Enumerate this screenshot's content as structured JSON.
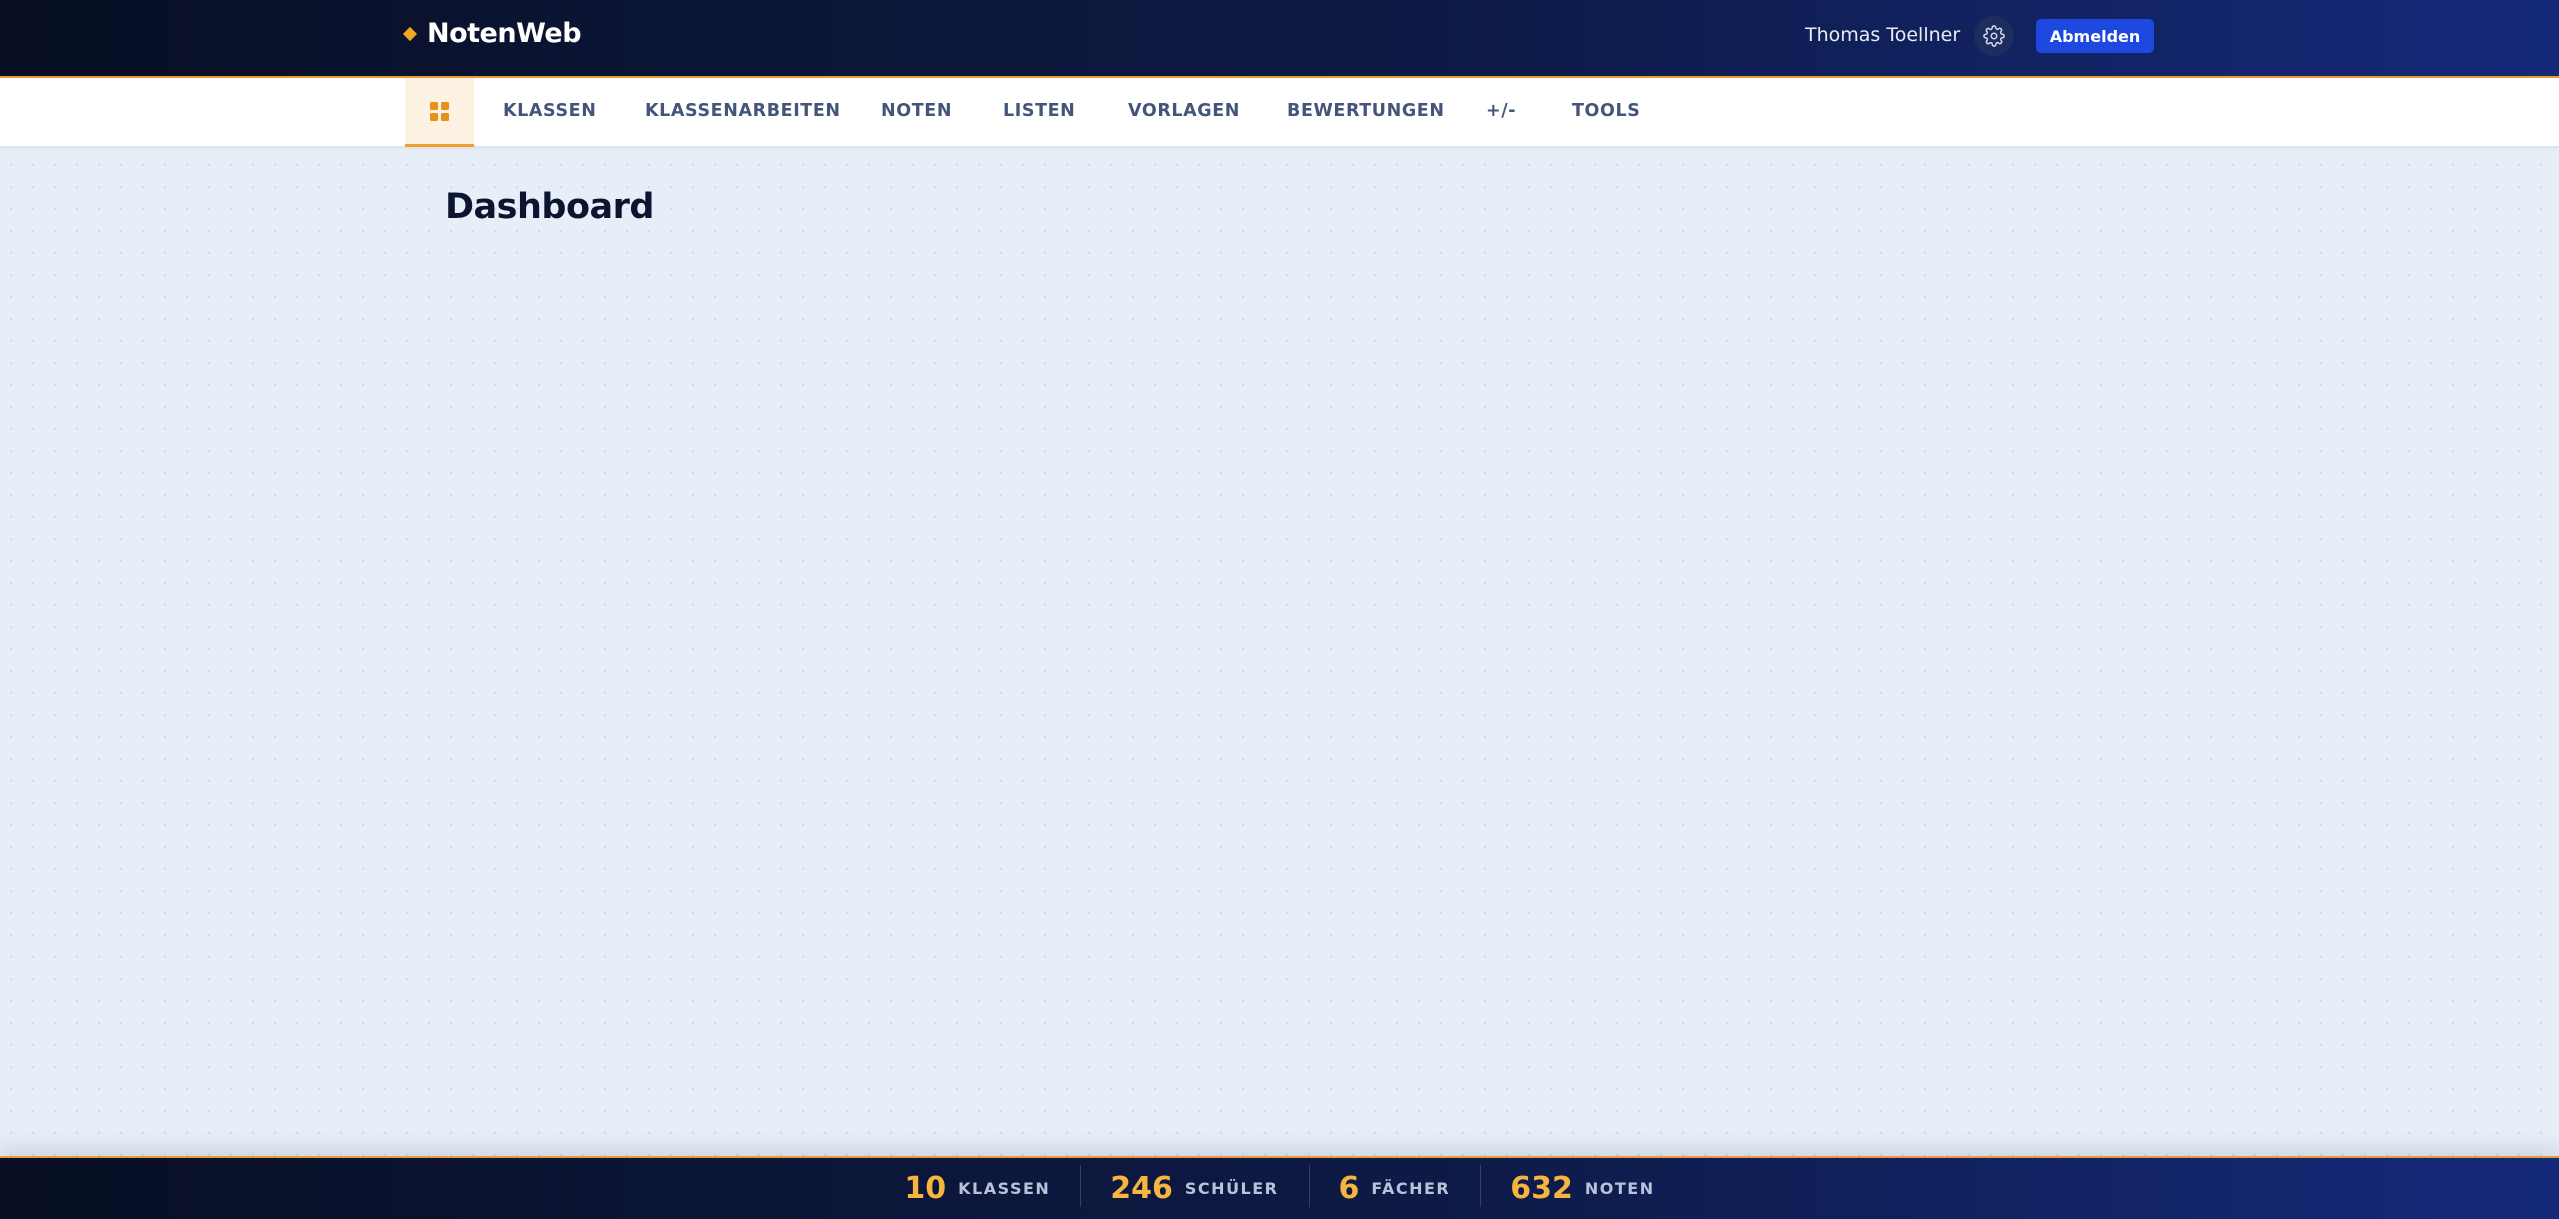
{
  "brand": {
    "name": "NotenWeb",
    "accent": "#f5a623"
  },
  "header": {
    "user_name": "Thomas Toellner",
    "settings_icon": "gear-icon",
    "logout_label": "Abmelden"
  },
  "nav": {
    "home_icon": "grid-icon",
    "items": [
      {
        "label": "KLASSEN"
      },
      {
        "label": "KLASSENARBEITEN"
      },
      {
        "label": "NOTEN"
      },
      {
        "label": "LISTEN"
      },
      {
        "label": "VORLAGEN"
      },
      {
        "label": "BEWERTUNGEN"
      },
      {
        "label": "+/-"
      },
      {
        "label": "TOOLS"
      }
    ]
  },
  "main": {
    "title": "Dashboard"
  },
  "footer": {
    "stats": [
      {
        "value": "10",
        "label": "KLASSEN"
      },
      {
        "value": "246",
        "label": "SCHÜLER"
      },
      {
        "value": "6",
        "label": "FÄCHER"
      },
      {
        "value": "632",
        "label": "NOTEN"
      }
    ]
  },
  "colors": {
    "header_bg": "#0d1a45",
    "accent_orange": "#f0a030",
    "button_blue": "#1e48e0",
    "page_bg": "#e8eef8"
  }
}
